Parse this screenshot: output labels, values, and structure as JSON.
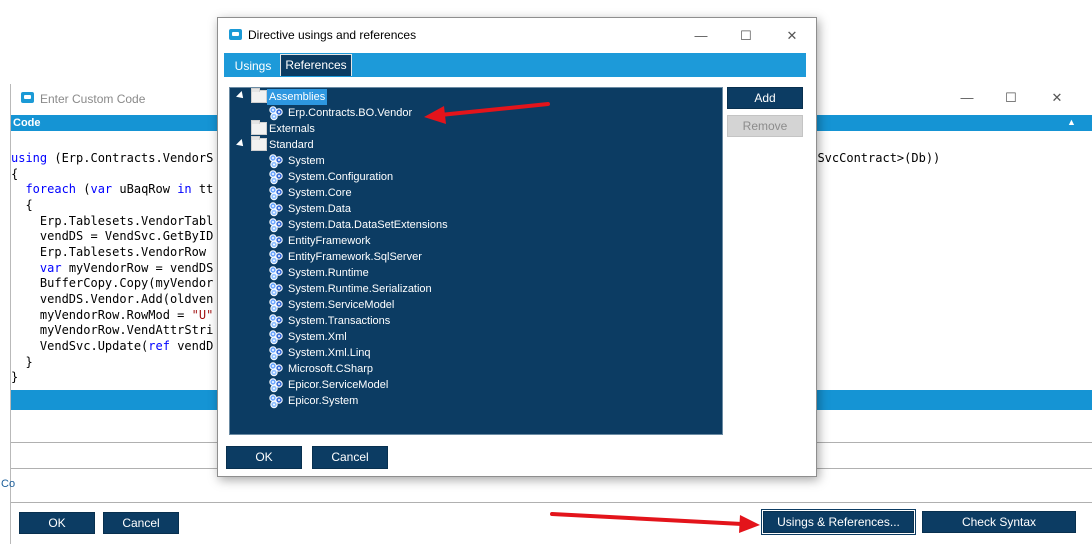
{
  "code_window": {
    "title": "Enter Custom Code",
    "header": "Code",
    "code_lines": [
      "using (Erp.Contracts.VendorS",
      "{",
      "  foreach (var uBaqRow in tt",
      "  {",
      "    Erp.Tablesets.VendorTabl",
      "    vendDS = VendSvc.GetByID",
      "    Erp.Tablesets.VendorRow ",
      "    var myVendorRow = vendDS",
      "    BufferCopy.Copy(myVendor",
      "    vendDS.Vendor.Add(oldven",
      "    myVendorRow.RowMod = \"U\"",
      "    myVendorRow.VendAttrStri",
      "    VendSvc.Update(ref vendD",
      "  }",
      "}"
    ],
    "code_right_fragment": "orSvcContract>(Db))",
    "left_stub_text": "Co",
    "ok_label": "OK",
    "cancel_label": "Cancel",
    "usings_references_label": "Usings & References...",
    "check_syntax_label": "Check Syntax"
  },
  "dialog": {
    "title": "Directive usings and references",
    "tabs": [
      {
        "label": "Usings",
        "active": false
      },
      {
        "label": "References",
        "active": true
      }
    ],
    "tree": {
      "assemblies_label": "Assemblies",
      "assemblies_children": [
        "Erp.Contracts.BO.Vendor"
      ],
      "externals_label": "Externals",
      "standard_label": "Standard",
      "standard_children": [
        "System",
        "System.Configuration",
        "System.Core",
        "System.Data",
        "System.Data.DataSetExtensions",
        "EntityFramework",
        "EntityFramework.SqlServer",
        "System.Runtime",
        "System.Runtime.Serialization",
        "System.ServiceModel",
        "System.Transactions",
        "System.Xml",
        "System.Xml.Linq",
        "Microsoft.CSharp",
        "Epicor.ServiceModel",
        "Epicor.System"
      ]
    },
    "add_label": "Add",
    "remove_label": "Remove",
    "ok_label": "OK",
    "cancel_label": "Cancel"
  },
  "colors": {
    "accent_blue": "#1d9ad9",
    "dark_navy": "#0c3c63",
    "selection": "#2d97e0",
    "annotation_red": "#e3141b"
  }
}
